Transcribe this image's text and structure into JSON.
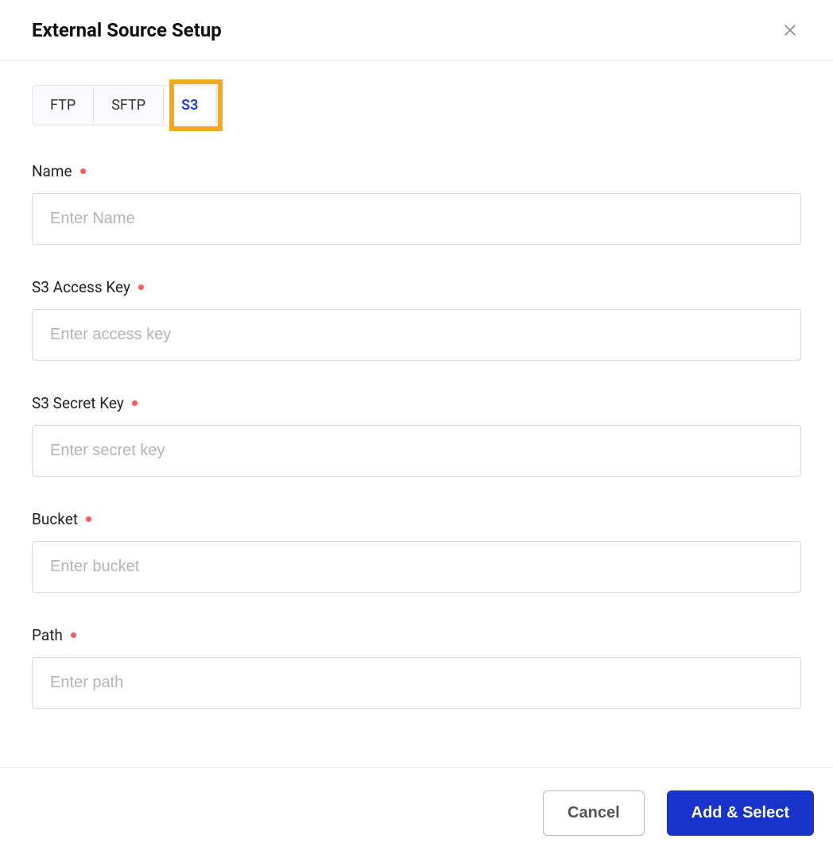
{
  "header": {
    "title": "External Source Setup"
  },
  "tabs": {
    "items": [
      {
        "label": "FTP"
      },
      {
        "label": "SFTP"
      },
      {
        "label": "S3"
      }
    ],
    "activeIndex": 2
  },
  "form": {
    "name": {
      "label": "Name",
      "placeholder": "Enter Name",
      "required": true
    },
    "accessKey": {
      "label": "S3 Access Key",
      "placeholder": "Enter access key",
      "required": true
    },
    "secretKey": {
      "label": "S3 Secret Key",
      "placeholder": "Enter secret key",
      "required": true
    },
    "bucket": {
      "label": "Bucket",
      "placeholder": "Enter bucket",
      "required": true
    },
    "path": {
      "label": "Path",
      "placeholder": "Enter path",
      "required": true
    }
  },
  "footer": {
    "cancel": "Cancel",
    "submit": "Add & Select"
  }
}
